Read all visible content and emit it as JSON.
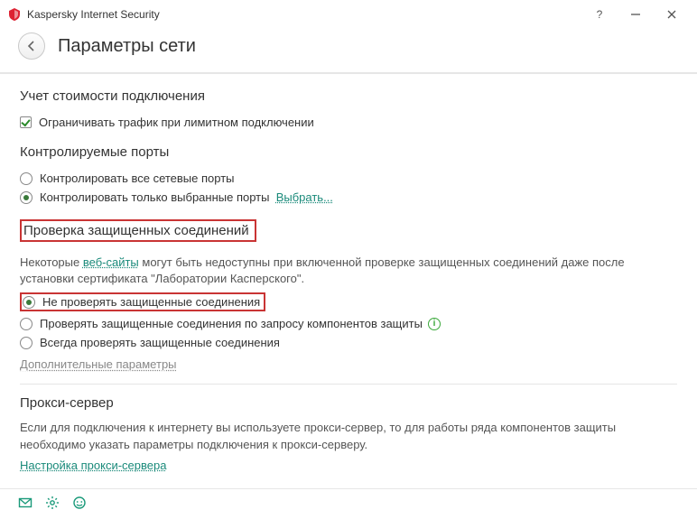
{
  "window": {
    "title": "Kaspersky Internet Security"
  },
  "header": {
    "page_title": "Параметры сети"
  },
  "s1": {
    "heading": "Учет стоимости подключения",
    "opt_limit": "Ограничивать трафик при лимитном подключении"
  },
  "s2": {
    "heading": "Контролируемые порты",
    "opt_all": "Контролировать все сетевые порты",
    "opt_selected": "Контролировать только выбранные порты",
    "select_link": "Выбрать..."
  },
  "s3": {
    "heading": "Проверка защищенных соединений",
    "desc_prefix": "Некоторые ",
    "desc_link": "веб-сайты",
    "desc_suffix": " могут быть недоступны при включенной проверке защищенных соединений даже после установки сертификата \"Лаборатории Касперского\".",
    "opt_never": "Не проверять защищенные соединения",
    "opt_request": "Проверять защищенные соединения по запросу компонентов защиты",
    "opt_always": "Всегда проверять защищенные соединения",
    "extra_link": "Дополнительные параметры"
  },
  "s4": {
    "heading": "Прокси-сервер",
    "desc": "Если для подключения к интернету вы используете прокси-сервер, то для работы ряда компонентов защиты необходимо указать параметры подключения к прокси-серверу.",
    "link": "Настройка прокси-сервера"
  }
}
